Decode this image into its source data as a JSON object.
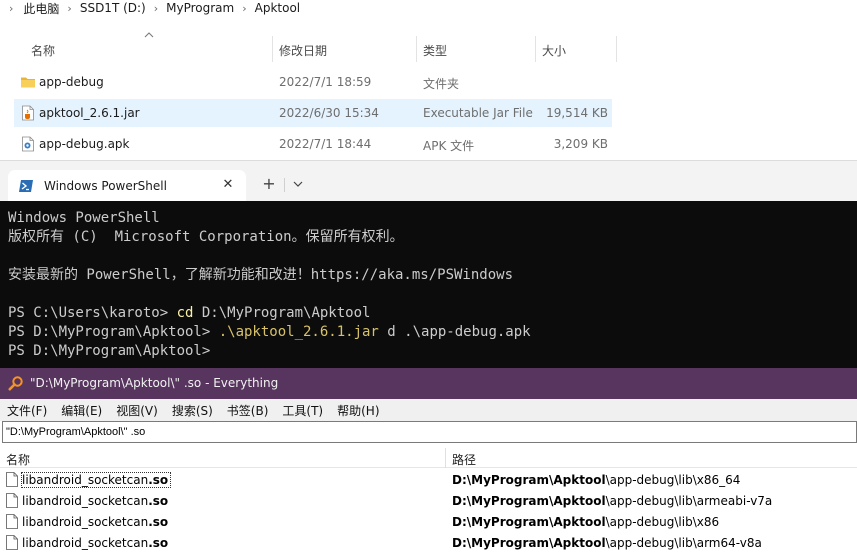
{
  "explorer": {
    "breadcrumb": [
      "此电脑",
      "SSD1T (D:)",
      "MyProgram",
      "Apktool"
    ],
    "columns": {
      "name": "名称",
      "date": "修改日期",
      "type": "类型",
      "size": "大小"
    },
    "files": [
      {
        "name": "app-debug",
        "date": "2022/7/1 18:59",
        "type": "文件夹",
        "size": "",
        "icon": "folder-icon",
        "selected": false
      },
      {
        "name": "apktool_2.6.1.jar",
        "date": "2022/6/30 15:34",
        "type": "Executable Jar File",
        "size": "19,514 KB",
        "icon": "jar-file-icon",
        "selected": true
      },
      {
        "name": "app-debug.apk",
        "date": "2022/7/1 18:44",
        "type": "APK 文件",
        "size": "3,209 KB",
        "icon": "apk-file-icon",
        "selected": false
      }
    ]
  },
  "terminal": {
    "tab_title": "Windows PowerShell",
    "banner_line1": "Windows PowerShell",
    "banner_line2": "版权所有 (C)  Microsoft Corporation。保留所有权利。",
    "banner_line3": "安装最新的 PowerShell，了解新功能和改进！https://aka.ms/PSWindows",
    "cmd1_prompt": "PS C:\\Users\\karoto> ",
    "cmd1_command": "cd",
    "cmd1_args": " D:\\MyProgram\\Apktool",
    "cmd2_prompt": "PS D:\\MyProgram\\Apktool> ",
    "cmd2_command": ".\\apktool_2.6.1.jar",
    "cmd2_args": " d .\\app-debug.apk",
    "cmd3_prompt": "PS D:\\MyProgram\\Apktool>",
    "colors": {
      "background": "#0c0c0c",
      "text": "#cccccc",
      "command": "#f9f1a5"
    }
  },
  "everything": {
    "title": "\"D:\\MyProgram\\Apktool\\\" .so - Everything",
    "menu": [
      "文件(F)",
      "编辑(E)",
      "视图(V)",
      "搜索(S)",
      "书签(B)",
      "工具(T)",
      "帮助(H)"
    ],
    "search_value": "\"D:\\MyProgram\\Apktool\\\" .so",
    "columns": {
      "name": "名称",
      "path": "路径"
    },
    "results": [
      {
        "name_plain": "libandroid_socketcan",
        "name_bold": ".so",
        "path_bold": "D:\\MyProgram\\Apktool",
        "path_plain": "\\app-debug\\lib\\x86_64"
      },
      {
        "name_plain": "libandroid_socketcan",
        "name_bold": ".so",
        "path_bold": "D:\\MyProgram\\Apktool",
        "path_plain": "\\app-debug\\lib\\armeabi-v7a"
      },
      {
        "name_plain": "libandroid_socketcan",
        "name_bold": ".so",
        "path_bold": "D:\\MyProgram\\Apktool",
        "path_plain": "\\app-debug\\lib\\x86"
      },
      {
        "name_plain": "libandroid_socketcan",
        "name_bold": ".so",
        "path_bold": "D:\\MyProgram\\Apktool",
        "path_plain": "\\app-debug\\lib\\arm64-v8a"
      }
    ],
    "colors": {
      "title_bar": "#57355f"
    }
  }
}
